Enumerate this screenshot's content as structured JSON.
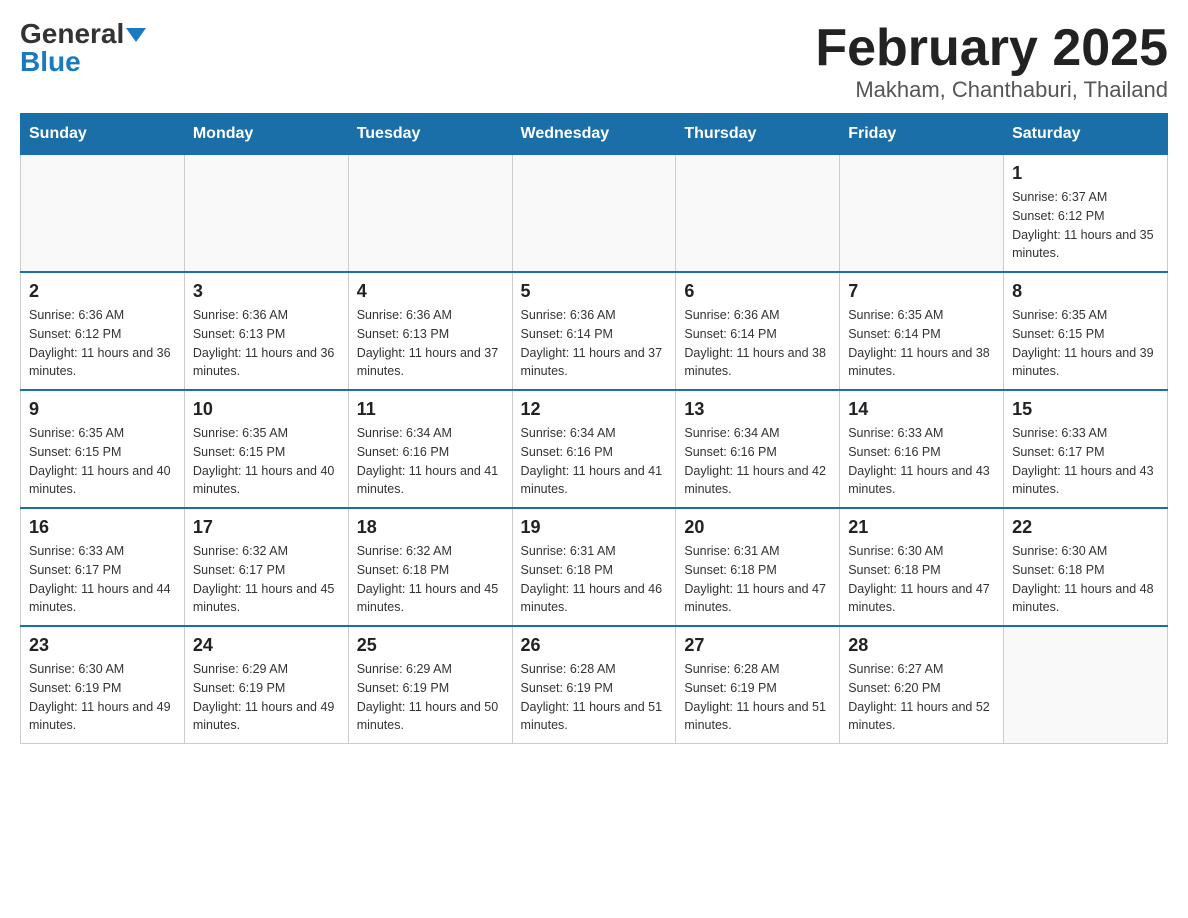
{
  "logo": {
    "general": "General",
    "blue": "Blue"
  },
  "title": {
    "month_year": "February 2025",
    "location": "Makham, Chanthaburi, Thailand"
  },
  "header_days": [
    "Sunday",
    "Monday",
    "Tuesday",
    "Wednesday",
    "Thursday",
    "Friday",
    "Saturday"
  ],
  "weeks": [
    [
      {
        "day": "",
        "info": ""
      },
      {
        "day": "",
        "info": ""
      },
      {
        "day": "",
        "info": ""
      },
      {
        "day": "",
        "info": ""
      },
      {
        "day": "",
        "info": ""
      },
      {
        "day": "",
        "info": ""
      },
      {
        "day": "1",
        "info": "Sunrise: 6:37 AM\nSunset: 6:12 PM\nDaylight: 11 hours and 35 minutes."
      }
    ],
    [
      {
        "day": "2",
        "info": "Sunrise: 6:36 AM\nSunset: 6:12 PM\nDaylight: 11 hours and 36 minutes."
      },
      {
        "day": "3",
        "info": "Sunrise: 6:36 AM\nSunset: 6:13 PM\nDaylight: 11 hours and 36 minutes."
      },
      {
        "day": "4",
        "info": "Sunrise: 6:36 AM\nSunset: 6:13 PM\nDaylight: 11 hours and 37 minutes."
      },
      {
        "day": "5",
        "info": "Sunrise: 6:36 AM\nSunset: 6:14 PM\nDaylight: 11 hours and 37 minutes."
      },
      {
        "day": "6",
        "info": "Sunrise: 6:36 AM\nSunset: 6:14 PM\nDaylight: 11 hours and 38 minutes."
      },
      {
        "day": "7",
        "info": "Sunrise: 6:35 AM\nSunset: 6:14 PM\nDaylight: 11 hours and 38 minutes."
      },
      {
        "day": "8",
        "info": "Sunrise: 6:35 AM\nSunset: 6:15 PM\nDaylight: 11 hours and 39 minutes."
      }
    ],
    [
      {
        "day": "9",
        "info": "Sunrise: 6:35 AM\nSunset: 6:15 PM\nDaylight: 11 hours and 40 minutes."
      },
      {
        "day": "10",
        "info": "Sunrise: 6:35 AM\nSunset: 6:15 PM\nDaylight: 11 hours and 40 minutes."
      },
      {
        "day": "11",
        "info": "Sunrise: 6:34 AM\nSunset: 6:16 PM\nDaylight: 11 hours and 41 minutes."
      },
      {
        "day": "12",
        "info": "Sunrise: 6:34 AM\nSunset: 6:16 PM\nDaylight: 11 hours and 41 minutes."
      },
      {
        "day": "13",
        "info": "Sunrise: 6:34 AM\nSunset: 6:16 PM\nDaylight: 11 hours and 42 minutes."
      },
      {
        "day": "14",
        "info": "Sunrise: 6:33 AM\nSunset: 6:16 PM\nDaylight: 11 hours and 43 minutes."
      },
      {
        "day": "15",
        "info": "Sunrise: 6:33 AM\nSunset: 6:17 PM\nDaylight: 11 hours and 43 minutes."
      }
    ],
    [
      {
        "day": "16",
        "info": "Sunrise: 6:33 AM\nSunset: 6:17 PM\nDaylight: 11 hours and 44 minutes."
      },
      {
        "day": "17",
        "info": "Sunrise: 6:32 AM\nSunset: 6:17 PM\nDaylight: 11 hours and 45 minutes."
      },
      {
        "day": "18",
        "info": "Sunrise: 6:32 AM\nSunset: 6:18 PM\nDaylight: 11 hours and 45 minutes."
      },
      {
        "day": "19",
        "info": "Sunrise: 6:31 AM\nSunset: 6:18 PM\nDaylight: 11 hours and 46 minutes."
      },
      {
        "day": "20",
        "info": "Sunrise: 6:31 AM\nSunset: 6:18 PM\nDaylight: 11 hours and 47 minutes."
      },
      {
        "day": "21",
        "info": "Sunrise: 6:30 AM\nSunset: 6:18 PM\nDaylight: 11 hours and 47 minutes."
      },
      {
        "day": "22",
        "info": "Sunrise: 6:30 AM\nSunset: 6:18 PM\nDaylight: 11 hours and 48 minutes."
      }
    ],
    [
      {
        "day": "23",
        "info": "Sunrise: 6:30 AM\nSunset: 6:19 PM\nDaylight: 11 hours and 49 minutes."
      },
      {
        "day": "24",
        "info": "Sunrise: 6:29 AM\nSunset: 6:19 PM\nDaylight: 11 hours and 49 minutes."
      },
      {
        "day": "25",
        "info": "Sunrise: 6:29 AM\nSunset: 6:19 PM\nDaylight: 11 hours and 50 minutes."
      },
      {
        "day": "26",
        "info": "Sunrise: 6:28 AM\nSunset: 6:19 PM\nDaylight: 11 hours and 51 minutes."
      },
      {
        "day": "27",
        "info": "Sunrise: 6:28 AM\nSunset: 6:19 PM\nDaylight: 11 hours and 51 minutes."
      },
      {
        "day": "28",
        "info": "Sunrise: 6:27 AM\nSunset: 6:20 PM\nDaylight: 11 hours and 52 minutes."
      },
      {
        "day": "",
        "info": ""
      }
    ]
  ]
}
